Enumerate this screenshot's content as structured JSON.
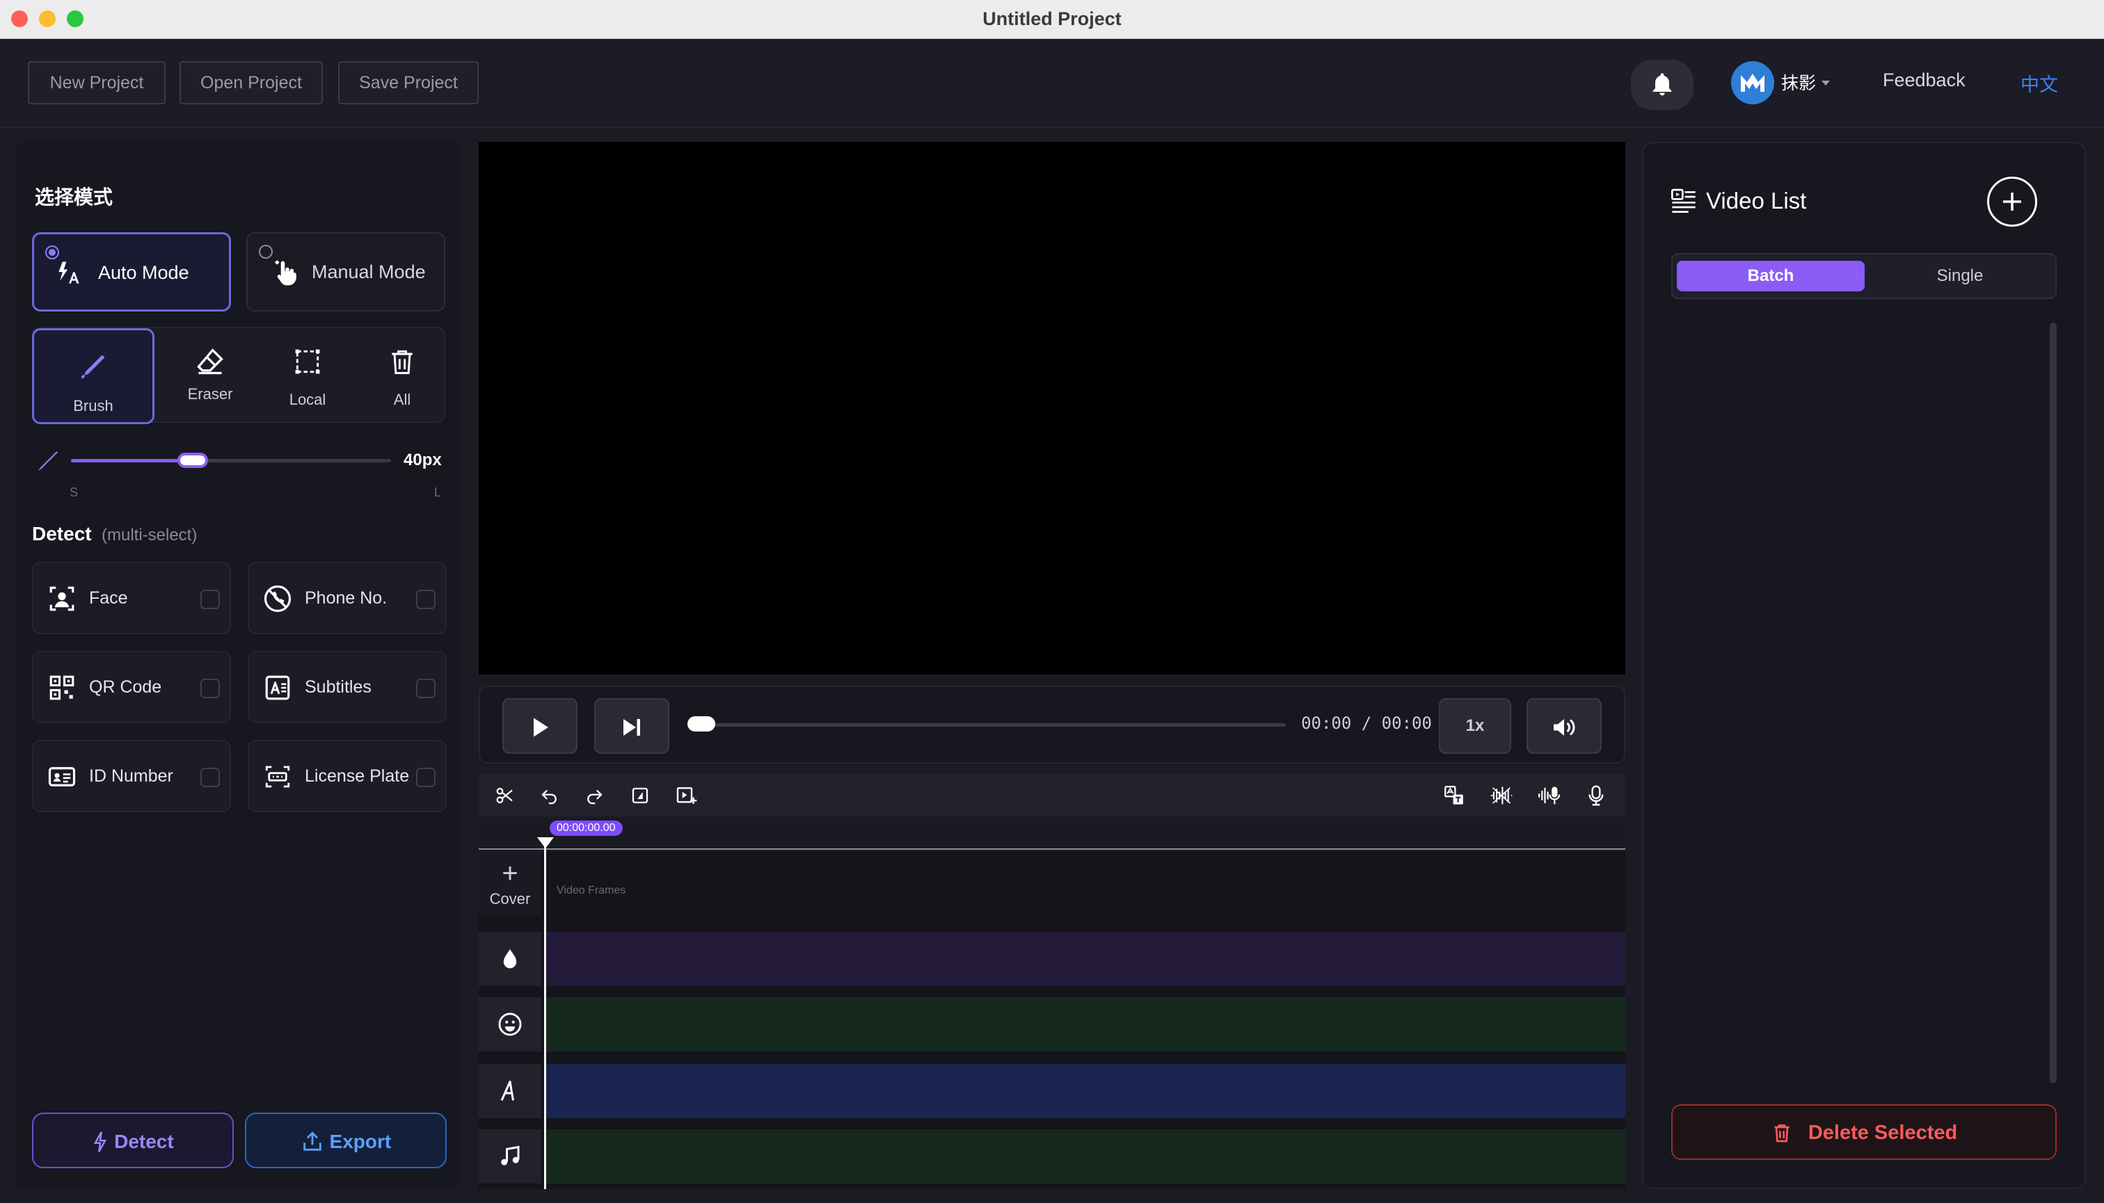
{
  "window": {
    "title": "Untitled Project"
  },
  "toolbar": {
    "new_project": "New Project",
    "open_project": "Open Project",
    "save_project": "Save Project",
    "username": "抹影",
    "feedback": "Feedback",
    "language": "中文"
  },
  "left": {
    "section_title": "选择模式",
    "modes": [
      {
        "label": "Auto Mode",
        "selected": true
      },
      {
        "label": "Manual Mode",
        "selected": false
      }
    ],
    "tools": [
      {
        "label": "Brush",
        "icon": "brush-icon",
        "selected": true
      },
      {
        "label": "Eraser",
        "icon": "eraser-icon"
      },
      {
        "label": "Local",
        "icon": "select-rect-icon"
      },
      {
        "label": "All",
        "icon": "trash-icon"
      }
    ],
    "brush_size": {
      "value_label": "40px",
      "min_label": "S",
      "max_label": "L",
      "fraction": 0.38
    },
    "detect_title": "Detect",
    "detect_subtitle": "(multi-select)",
    "detect_options": [
      {
        "label": "Face",
        "icon": "face-icon",
        "checked": false
      },
      {
        "label": "Phone No.",
        "icon": "phone-icon",
        "checked": false
      },
      {
        "label": "QR Code",
        "icon": "qr-code-icon",
        "checked": false
      },
      {
        "label": "Subtitles",
        "icon": "subtitles-icon",
        "checked": false
      },
      {
        "label": "ID Number",
        "icon": "id-card-icon",
        "checked": false
      },
      {
        "label": "License Plate",
        "icon": "license-plate-icon",
        "checked": false
      }
    ],
    "detect_button": "Detect",
    "export_button": "Export"
  },
  "player": {
    "time": "00:00 / 00:00",
    "speed": "1x",
    "progress": 0
  },
  "timeline": {
    "timecode": "00:00:00.00",
    "cover_label": "Cover",
    "frames_label": "Video Frames",
    "track_icons": [
      "droplet-icon",
      "emoji-icon",
      "text-icon",
      "music-icon"
    ]
  },
  "right": {
    "title": "Video List",
    "tabs": [
      {
        "label": "Batch",
        "active": true
      },
      {
        "label": "Single",
        "active": false
      }
    ],
    "delete_button": "Delete Selected"
  },
  "colors": {
    "accent": "#8b5cf6",
    "accent_border": "#6a6ae0",
    "export_blue": "#5aa0ff",
    "delete_red": "#ff5a5a",
    "language_blue": "#3b82f6"
  }
}
